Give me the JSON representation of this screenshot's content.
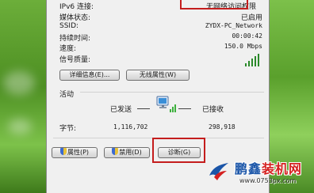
{
  "details": {
    "ipv6_label": "IPv6 连接:",
    "ipv6_value": "无网络访问权限",
    "media_label": "媒体状态:",
    "media_value": "已启用",
    "ssid_label": "SSID:",
    "ssid_value": "ZYDX-PC_Network",
    "duration_label": "持续时间:",
    "duration_value": "00:00:42",
    "speed_label": "速度:",
    "speed_value": "150.0 Mbps",
    "signal_label": "信号质量:",
    "signal_bars_active": 5,
    "signal_bars_total": 5
  },
  "buttons": {
    "details": "详细信息(E)...",
    "wireless_props": "无线属性(W)",
    "properties": "属性(P)",
    "disable": "禁用(D)",
    "diagnose": "诊断(G)"
  },
  "activity": {
    "title": "活动",
    "sent_label": "已发送",
    "received_label": "已接收",
    "bytes_label": "字节:",
    "bytes_sent": "1,116,702",
    "bytes_received": "298,918"
  },
  "watermark": {
    "brand_part1": "鹏鑫",
    "brand_part2": "装机网",
    "url": "www.0753px.com"
  },
  "colors": {
    "highlight": "#c41d1d",
    "signal": "#3cb03c",
    "brand_blue": "#1a55a8",
    "brand_red": "#d42020"
  }
}
